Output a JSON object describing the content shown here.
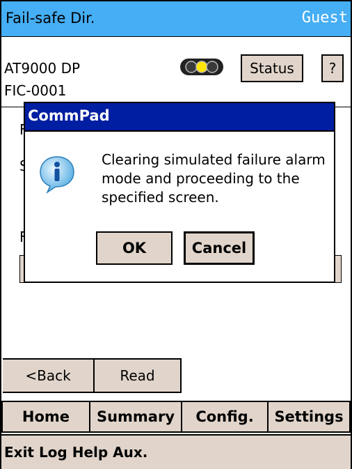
{
  "header": {
    "title": "Fail-safe Dir.",
    "user": "Guest"
  },
  "device": {
    "model": "AT9000 DP",
    "tag": "FIC-0001",
    "status_label": "Status",
    "help_label": "?"
  },
  "background_fragments": [
    "F",
    "S",
    "F"
  ],
  "dialog": {
    "title": "CommPad",
    "message": "Clearing simulated failure alarm mode and proceeding to the specified screen.",
    "ok_label": "OK",
    "cancel_label": "Cancel",
    "icon": "info-icon"
  },
  "nav": {
    "back_label": "<Back",
    "read_label": "Read"
  },
  "tabs": [
    "Home",
    "Summary",
    "Config.",
    "Settings"
  ],
  "menu": {
    "text": "Exit Log Help Aux."
  },
  "colors": {
    "titlebar": "#45aef5",
    "dialog_title": "#001ea1",
    "button": "#e1d5cb"
  }
}
